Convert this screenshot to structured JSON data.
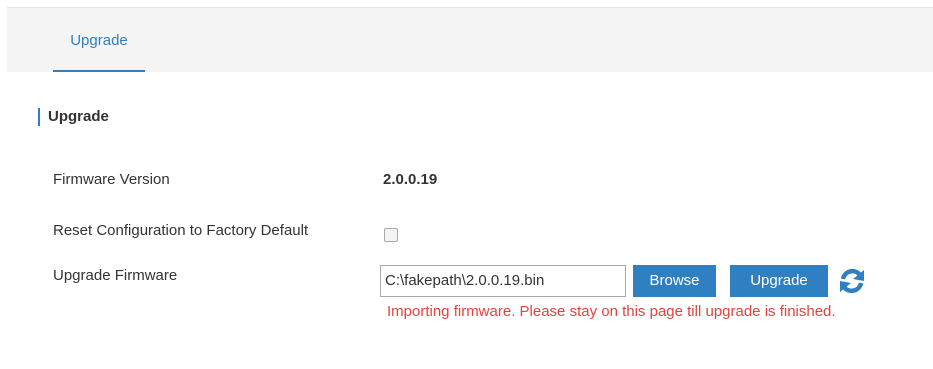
{
  "tabs": [
    {
      "label": "Upgrade",
      "active": true
    }
  ],
  "section": {
    "title": "Upgrade"
  },
  "rows": {
    "firmware_version": {
      "label": "Firmware Version",
      "value": "2.0.0.19"
    },
    "reset_config": {
      "label": "Reset Configuration to Factory Default",
      "checked": false
    },
    "upgrade_firmware": {
      "label": "Upgrade Firmware",
      "file_value": "C:\\fakepath\\2.0.0.19.bin",
      "browse_label": "Browse",
      "upgrade_label": "Upgrade",
      "refresh_icon": "refresh-icon",
      "status_message": "Importing firmware. Please stay on this page till upgrade is finished."
    }
  },
  "colors": {
    "accent": "#2f7fc1",
    "error": "#e0443f",
    "tabbar_bg": "#f4f4f4"
  }
}
